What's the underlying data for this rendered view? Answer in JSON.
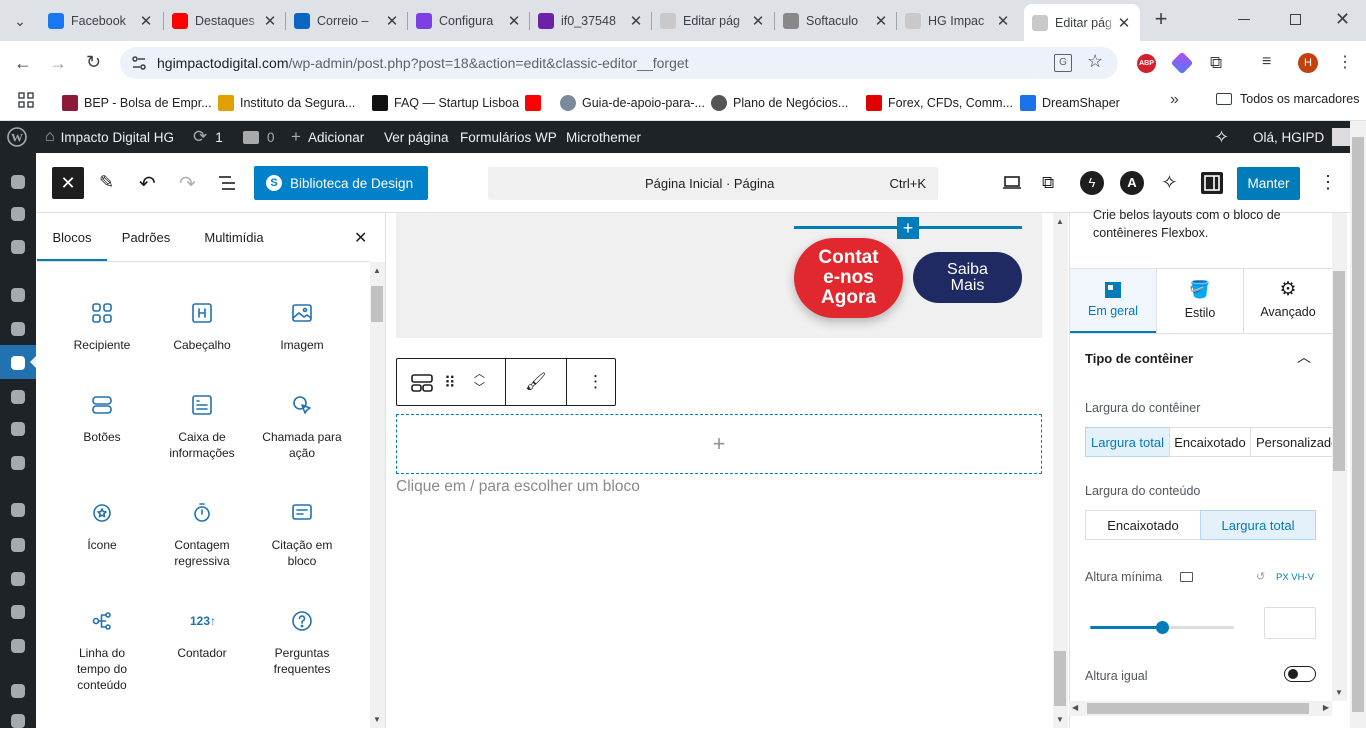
{
  "browser": {
    "tabs": [
      {
        "title": "Facebook",
        "color": "#1877f2"
      },
      {
        "title": "Destaques",
        "color": "#ff0000"
      },
      {
        "title": "Correio – ",
        "color": "#0a66c2"
      },
      {
        "title": "Configura",
        "color": "#7b3fe4"
      },
      {
        "title": "if0_37548",
        "color": "#6b21a8"
      },
      {
        "title": "Editar pág",
        "color": "#c9c9c9"
      },
      {
        "title": "Softaculo",
        "color": "#888888"
      },
      {
        "title": "HG Impac",
        "color": "#c9c9c9"
      },
      {
        "title": "Editar pág",
        "color": "#c9c9c9"
      }
    ],
    "url_host": "hgimpactodigital.com",
    "url_path": "/wp-admin/post.php?post=18&action=edit&classic-editor__forget",
    "bookmarks": [
      "BEP - Bolsa de Empr...",
      "Instituto da Segura...",
      "FAQ — Startup Lisboa",
      "",
      "Guia-de-apoio-para-...",
      "Plano de Negócios...",
      "Forex, CFDs, Comm...",
      "DreamShaper"
    ],
    "all_bookmarks": "Todos os marcadores",
    "profile_initial": "H",
    "abp": "ABP"
  },
  "adminbar": {
    "site": "Impacto Digital HG",
    "updates": "1",
    "comments": "0",
    "add": "Adicionar",
    "view": "Ver página",
    "forms": "Formulários WP",
    "microthemer": "Microthemer",
    "greeting": "Olá, HGIPD"
  },
  "header": {
    "design_library": "Biblioteca de Design",
    "doc_title": "Página Inicial · Página",
    "shortcut": "Ctrl+K",
    "save": "Manter"
  },
  "inserter": {
    "tabs": [
      "Blocos",
      "Padrões",
      "Multimídia"
    ],
    "blocks": [
      {
        "label": "Recipiente",
        "icon": "container-icon"
      },
      {
        "label": "Cabeçalho",
        "icon": "heading-icon"
      },
      {
        "label": "Imagem",
        "icon": "image-icon"
      },
      {
        "label": "Botões",
        "icon": "buttons-icon"
      },
      {
        "label": "Caixa de informações",
        "icon": "info-box-icon"
      },
      {
        "label": "Chamada para ação",
        "icon": "call-to-action-icon"
      },
      {
        "label": "Ícone",
        "icon": "star-icon"
      },
      {
        "label": "Contagem regressiva",
        "icon": "timer-icon"
      },
      {
        "label": "Citação em bloco",
        "icon": "quote-icon"
      },
      {
        "label": "Linha do tempo do conteúdo",
        "icon": "timeline-icon"
      },
      {
        "label": "Contador",
        "icon": "counter-icon"
      },
      {
        "label": "Perguntas frequentes",
        "icon": "faq-icon"
      }
    ]
  },
  "canvas": {
    "btn_contact": "Contat e-nos Agora",
    "btn_more": "Saiba Mais",
    "placeholder": "Clique em / para escolher um bloco",
    "colors": {
      "contact": "#e0282e",
      "more": "#1f2a63",
      "accent": "#007cba"
    }
  },
  "settings": {
    "intro": "Crie belos layouts com o bloco de contêineres Flexbox.",
    "tabs": [
      "Em geral",
      "Estilo",
      "Avançado"
    ],
    "section": "Tipo de contêiner",
    "container_width_label": "Largura do contêiner",
    "container_width_options": [
      "Largura total",
      "Encaixotado",
      "Personalizado"
    ],
    "content_width_label": "Largura do conteúdo",
    "content_width_options": [
      "Encaixotado",
      "Largura total"
    ],
    "min_height_label": "Altura mínima",
    "units": "PX  VH-V",
    "min_height_value": "",
    "min_height_slider": 0.5,
    "equal_height_label": "Altura igual"
  }
}
